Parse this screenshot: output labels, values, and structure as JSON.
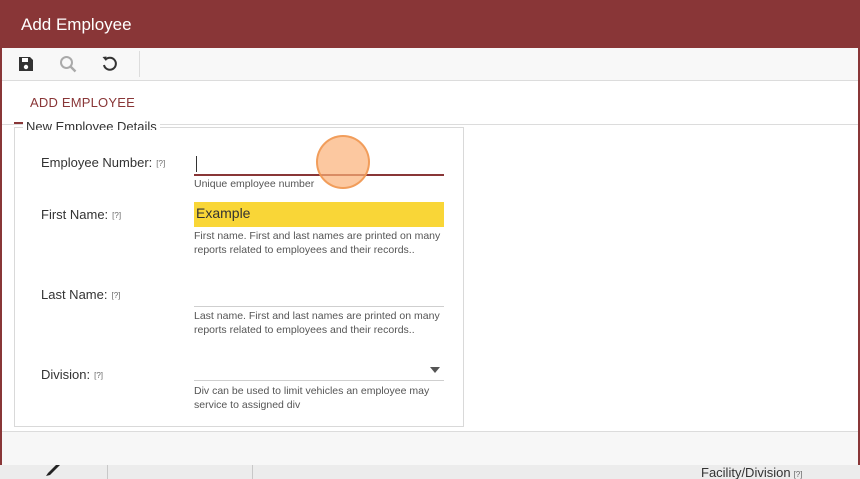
{
  "dialog": {
    "title": "Add Employee"
  },
  "toolbar": {
    "buttons": [
      {
        "icon": "save-icon"
      },
      {
        "icon": "search-icon",
        "disabled": true
      },
      {
        "icon": "undo-icon"
      }
    ]
  },
  "tabs": [
    {
      "label": "ADD EMPLOYEE",
      "active": true
    }
  ],
  "form": {
    "legend": "New Employee Details",
    "help_marker": "[?]",
    "fields": [
      {
        "label": "Employee Number:",
        "value": "",
        "hint": "Unique employee number"
      },
      {
        "label": "First Name:",
        "value": "Example",
        "hint": "First name. First and last names are printed on many reports related to employees and their records.."
      },
      {
        "label": "Last Name:",
        "value": "",
        "hint": "Last name. First and last names are printed on many reports related to employees and their records.."
      },
      {
        "label": "Division:",
        "value": "",
        "hint": "Div can be used to limit vehicles an employee may service to assigned div"
      }
    ]
  },
  "background": {
    "column_header": "Facility/Division",
    "help_marker": "[?]"
  },
  "colors": {
    "accent": "#893637",
    "highlight": "#f9d637",
    "click_indicator": "#fbb078"
  }
}
